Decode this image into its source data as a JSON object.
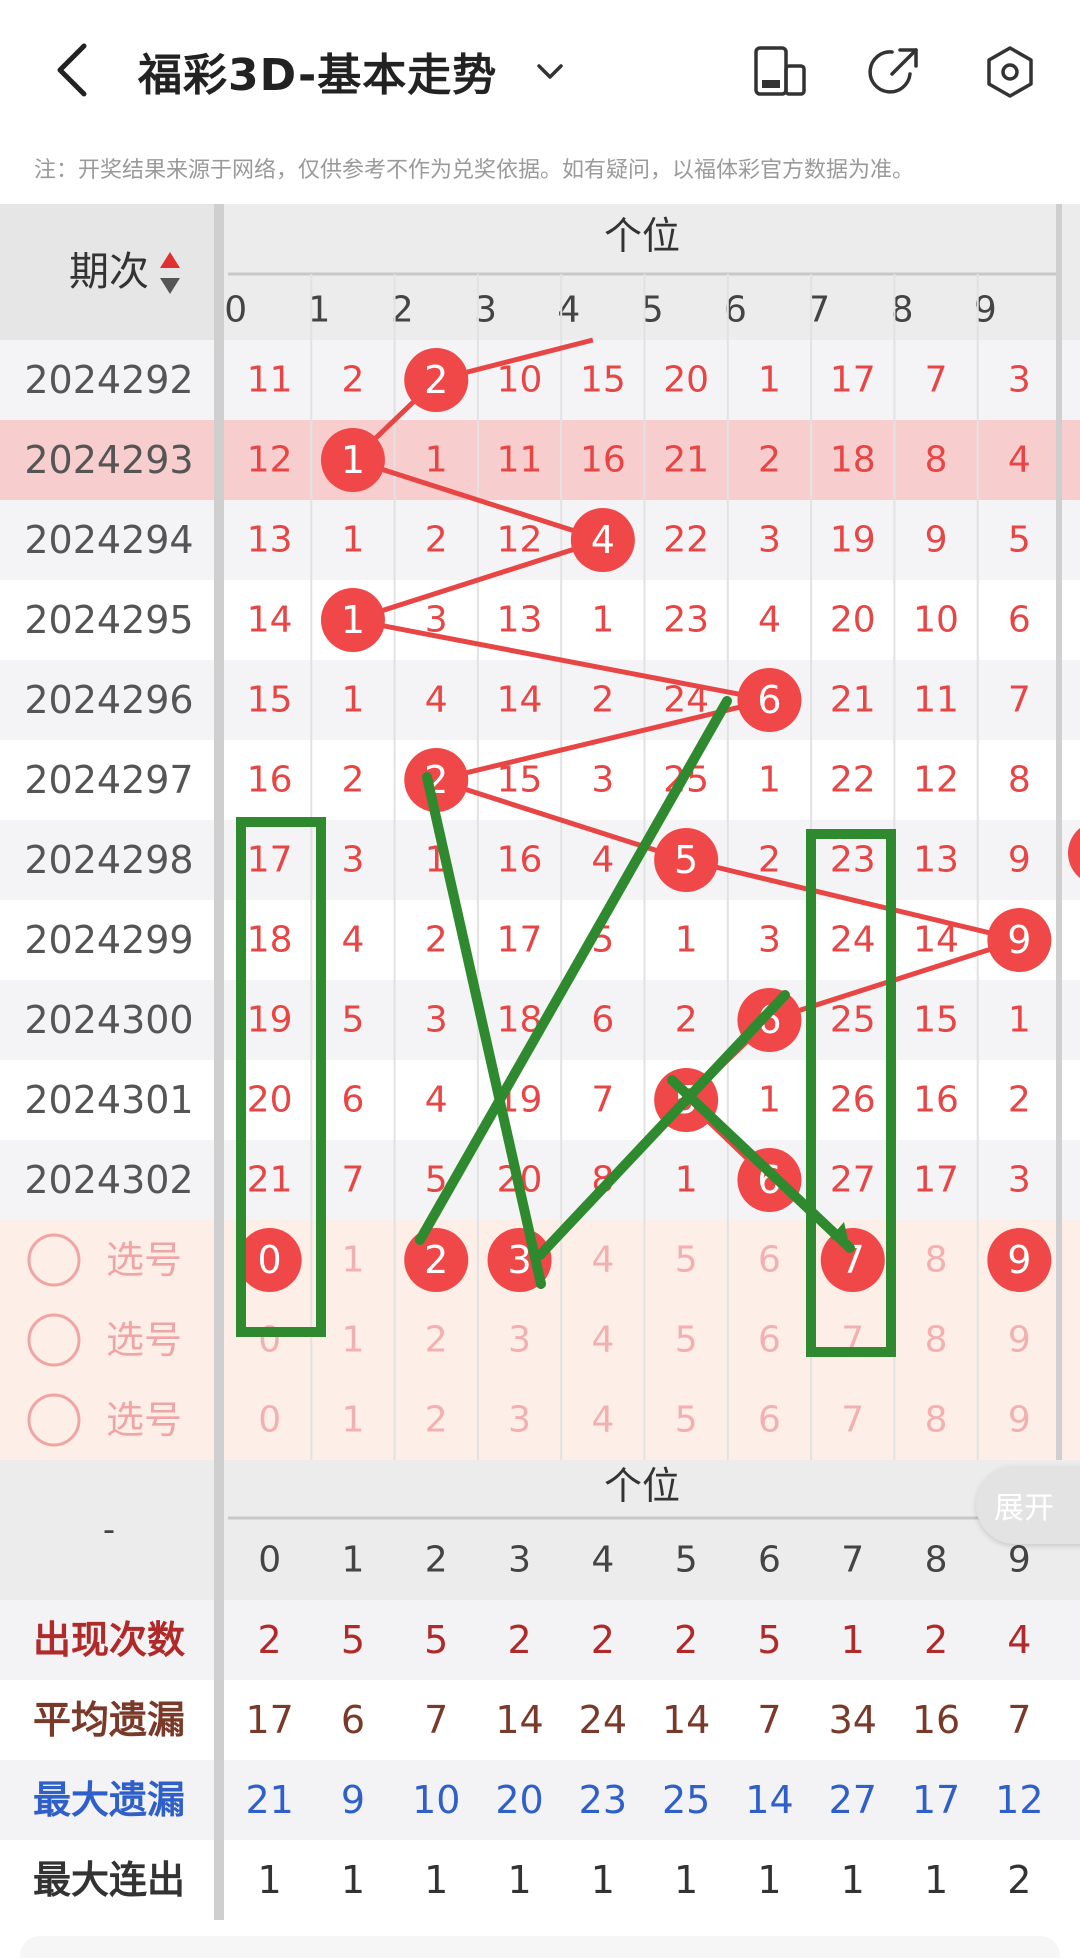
{
  "header": {
    "title": "福彩3D-基本走势",
    "icons": [
      "back-icon",
      "chevron-down-icon",
      "layout-icon",
      "share-icon",
      "settings-icon"
    ]
  },
  "notice": "注：开奖结果来源于网络，仅供参考不作为兑奖依据。如有疑问，以福体彩官方数据为准。",
  "grid": {
    "period_header": "期次",
    "group_header": "个位",
    "digits": [
      "0",
      "1",
      "2",
      "3",
      "4",
      "5",
      "6",
      "7",
      "8",
      "9"
    ],
    "rows": [
      {
        "period": "2024292",
        "cells": [
          "11",
          "2",
          "2",
          "10",
          "15",
          "20",
          "1",
          "17",
          "7",
          "3"
        ],
        "hit": 2
      },
      {
        "period": "2024293",
        "cells": [
          "12",
          "1",
          "1",
          "11",
          "16",
          "21",
          "2",
          "18",
          "8",
          "4"
        ],
        "hit": 1
      },
      {
        "period": "2024294",
        "cells": [
          "13",
          "1",
          "2",
          "12",
          "4",
          "22",
          "3",
          "19",
          "9",
          "5"
        ],
        "hit": 4
      },
      {
        "period": "2024295",
        "cells": [
          "14",
          "1",
          "3",
          "13",
          "1",
          "23",
          "4",
          "20",
          "10",
          "6"
        ],
        "hit": 1
      },
      {
        "period": "2024296",
        "cells": [
          "15",
          "1",
          "4",
          "14",
          "2",
          "24",
          "6",
          "21",
          "11",
          "7"
        ],
        "hit": 6
      },
      {
        "period": "2024297",
        "cells": [
          "16",
          "2",
          "2",
          "15",
          "3",
          "25",
          "1",
          "22",
          "12",
          "8"
        ],
        "hit": 2
      },
      {
        "period": "2024298",
        "cells": [
          "17",
          "3",
          "1",
          "16",
          "4",
          "5",
          "2",
          "23",
          "13",
          "9"
        ],
        "hit": 5
      },
      {
        "period": "2024299",
        "cells": [
          "18",
          "4",
          "2",
          "17",
          "5",
          "1",
          "3",
          "24",
          "14",
          "9"
        ],
        "hit": 9
      },
      {
        "period": "2024300",
        "cells": [
          "19",
          "5",
          "3",
          "18",
          "6",
          "2",
          "6",
          "25",
          "15",
          "1"
        ],
        "hit": 6
      },
      {
        "period": "2024301",
        "cells": [
          "20",
          "6",
          "4",
          "19",
          "7",
          "5",
          "1",
          "26",
          "16",
          "2"
        ],
        "hit": 5
      },
      {
        "period": "2024302",
        "cells": [
          "21",
          "7",
          "5",
          "20",
          "8",
          "1",
          "6",
          "27",
          "17",
          "3"
        ],
        "hit": 6
      }
    ],
    "highlight_period": "2024293",
    "select_rows": [
      {
        "label": "选号",
        "selected": [
          "0",
          "2",
          "3",
          "7",
          "9"
        ]
      },
      {
        "label": "选号",
        "selected": []
      },
      {
        "label": "选号",
        "selected": []
      }
    ]
  },
  "stats": {
    "left_header": "-",
    "group_header": "个位",
    "expand_label": "展开",
    "rows": [
      {
        "label": "出现次数",
        "values": [
          "2",
          "5",
          "5",
          "2",
          "2",
          "2",
          "5",
          "1",
          "2",
          "4"
        ],
        "color": "#b02a2a"
      },
      {
        "label": "平均遗漏",
        "values": [
          "17",
          "6",
          "7",
          "14",
          "24",
          "14",
          "7",
          "34",
          "16",
          "7"
        ],
        "color": "#7a3a2a"
      },
      {
        "label": "最大遗漏",
        "values": [
          "21",
          "9",
          "10",
          "20",
          "23",
          "25",
          "14",
          "27",
          "17",
          "12"
        ],
        "color": "#2f5fc8"
      },
      {
        "label": "最大连出",
        "values": [
          "1",
          "1",
          "1",
          "1",
          "1",
          "1",
          "1",
          "1",
          "1",
          "2"
        ],
        "color": "#333333"
      }
    ]
  },
  "colors": {
    "red": "#e84545",
    "ball": "#f04848",
    "green": "#2f8a2f",
    "header_bg": "#ececec",
    "highlight": "#f7cdcd",
    "select_bg": "#fdeee8"
  }
}
